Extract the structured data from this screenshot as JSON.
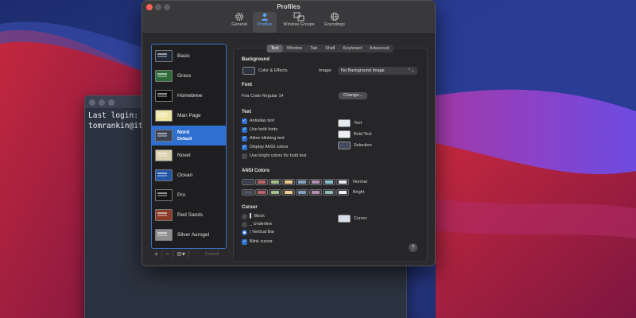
{
  "terminal": {
    "lines": [
      "Last login: Th",
      "tomrankin@its"
    ]
  },
  "prefs_window": {
    "title": "Profiles",
    "toolbar": [
      {
        "label": "General",
        "icon": "gear-icon"
      },
      {
        "label": "Profiles",
        "icon": "profiles-icon",
        "active": true
      },
      {
        "label": "Window Groups",
        "icon": "window-groups-icon"
      },
      {
        "label": "Encodings",
        "icon": "globe-icon"
      }
    ]
  },
  "profiles": [
    {
      "name": "Basic",
      "thumb": "#1f2733"
    },
    {
      "name": "Grass",
      "thumb": "#2f6b3a"
    },
    {
      "name": "Homebrew",
      "thumb": "#0d0d0d"
    },
    {
      "name": "Man Page",
      "thumb": "#efe6a4"
    },
    {
      "name": "Nord",
      "sub": "Default",
      "thumb": "#3b4252",
      "selected": true
    },
    {
      "name": "Novel",
      "thumb": "#d9cfae"
    },
    {
      "name": "Ocean",
      "thumb": "#2356a8"
    },
    {
      "name": "Pro",
      "thumb": "#151515"
    },
    {
      "name": "Red Sands",
      "thumb": "#8a3a26"
    },
    {
      "name": "Silver Aerogel",
      "thumb": "#8e8e90"
    }
  ],
  "list_footer": {
    "add": "+",
    "remove": "−",
    "more": "⊖▾",
    "default": "Default"
  },
  "tabs": [
    {
      "label": "Text",
      "active": true
    },
    {
      "label": "Window"
    },
    {
      "label": "Tab"
    },
    {
      "label": "Shell"
    },
    {
      "label": "Keyboard"
    },
    {
      "label": "Advanced"
    }
  ],
  "background": {
    "title": "Background",
    "color_label": "Color & Effects",
    "image_label": "Image:",
    "image_value": "No Background Image"
  },
  "font": {
    "title": "Font",
    "value": "Fira Code Regular 14",
    "change_button": "Change..."
  },
  "text": {
    "title": "Text",
    "options": [
      {
        "label": "Antialias text",
        "checked": true
      },
      {
        "label": "Use bold fonts",
        "checked": true
      },
      {
        "label": "Allow blinking text",
        "checked": true
      },
      {
        "label": "Display ANSI colors",
        "checked": true
      },
      {
        "label": "Use bright colors for bold text",
        "checked": false
      }
    ],
    "color_labels": [
      "Text",
      "Bold Text",
      "Selection"
    ]
  },
  "ansi": {
    "title": "ANSI Colors",
    "normal_label": "Normal",
    "bright_label": "Bright",
    "normal": [
      "#3b4252",
      "#bf616a",
      "#a3be8c",
      "#ebcb8b",
      "#81a1c1",
      "#b48ead",
      "#88c0d0",
      "#e5e9f0"
    ],
    "bright": [
      "#4c566a",
      "#bf616a",
      "#a3be8c",
      "#ebcb8b",
      "#81a1c1",
      "#b48ead",
      "#8fbcbb",
      "#eceff4"
    ]
  },
  "cursor": {
    "title": "Cursor",
    "options": [
      {
        "glyph": "▌",
        "label": "Block",
        "selected": false
      },
      {
        "glyph": "_",
        "label": "Underline",
        "selected": false
      },
      {
        "glyph": "|",
        "label": "Vertical Bar",
        "selected": true
      }
    ],
    "blink_label": "Blink cursor",
    "blink_checked": true,
    "cursor_color_label": "Cursor"
  },
  "help": "?"
}
